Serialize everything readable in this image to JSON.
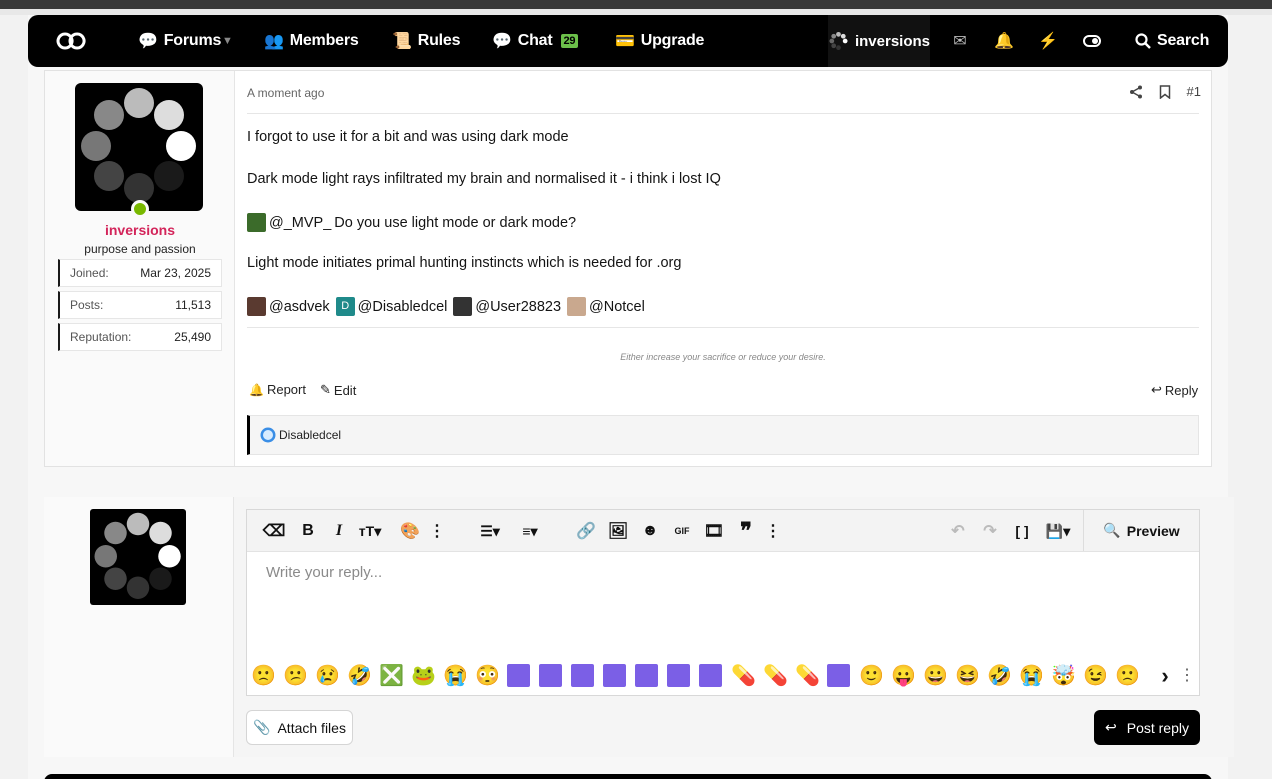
{
  "nav": {
    "forums": "Forums",
    "members": "Members",
    "rules": "Rules",
    "chat": "Chat",
    "chat_count": "29",
    "upgrade": "Upgrade",
    "username": "inversions",
    "search": "Search"
  },
  "post": {
    "author": "inversions",
    "author_title": "purpose and passion",
    "stats": [
      {
        "label": "Joined:",
        "value": "Mar 23, 2025"
      },
      {
        "label": "Posts:",
        "value": "11,513"
      },
      {
        "label": "Reputation:",
        "value": "25,490"
      }
    ],
    "date": "A moment ago",
    "number": "#1",
    "lines": [
      "I forgot to use it for a bit and was using dark mode",
      "Dark mode light rays infiltrated my brain and normalised it - i think i lost IQ",
      "Light mode initiates primal hunting instincts which is needed for .org"
    ],
    "mention1": "@_MVP_",
    "mention1_text": "Do you use light mode or dark mode?",
    "mentions": [
      "@asdvek",
      "@Disabledcel",
      "@User28823",
      "@Notcel"
    ],
    "signature": "Either increase your sacrifice or reduce your desire.",
    "report": "Report",
    "edit": "Edit",
    "reply": "Reply",
    "reaction_user": "Disabledcel"
  },
  "editor": {
    "placeholder": "Write your reply...",
    "preview": "Preview",
    "attach": "Attach files",
    "post_reply": "Post reply"
  },
  "colors": {
    "accent_name": "#d3245a",
    "online": "#78b800",
    "chat_badge": "#6cc04a"
  }
}
